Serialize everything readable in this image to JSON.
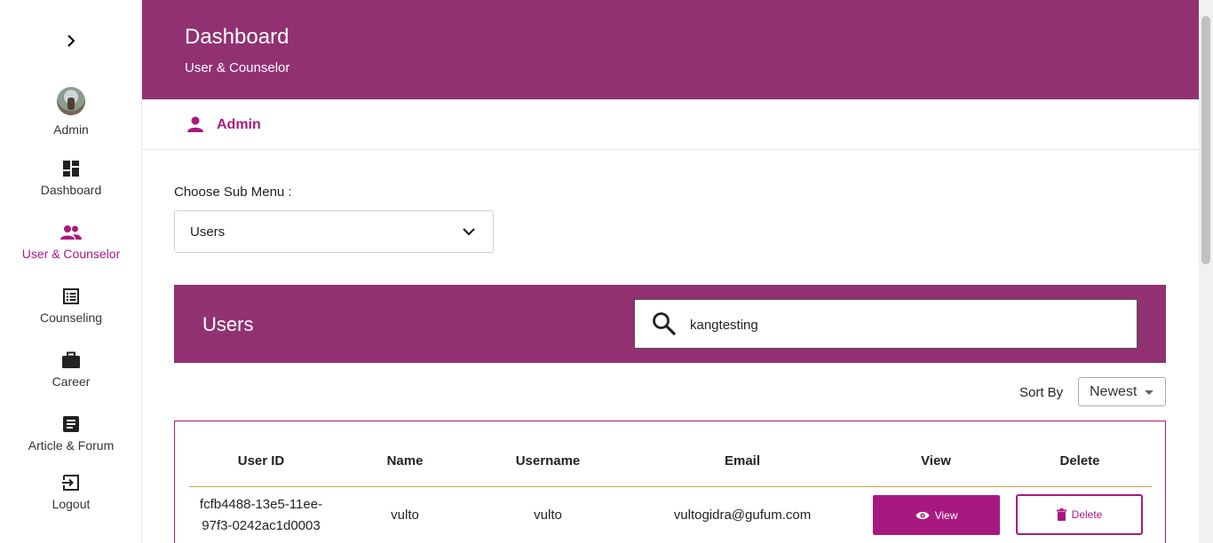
{
  "sidebar": {
    "items": [
      {
        "label": "Admin",
        "icon": "avatar"
      },
      {
        "label": "Dashboard",
        "icon": "dashboard-icon"
      },
      {
        "label": "User & Counselor",
        "icon": "people-icon",
        "active": true
      },
      {
        "label": "Counseling",
        "icon": "list-icon"
      },
      {
        "label": "Career",
        "icon": "briefcase-icon"
      },
      {
        "label": "Article & Forum",
        "icon": "article-icon"
      },
      {
        "label": "Logout",
        "icon": "logout-icon"
      }
    ]
  },
  "header": {
    "title": "Dashboard",
    "subtitle": "User & Counselor"
  },
  "admin_bar": {
    "label": "Admin"
  },
  "submenu": {
    "label": "Choose Sub Menu :",
    "selected": "Users"
  },
  "users_panel": {
    "title": "Users",
    "search_value": "kangtesting"
  },
  "sort": {
    "label": "Sort By",
    "selected": "Newest"
  },
  "table": {
    "headers": [
      "User ID",
      "Name",
      "Username",
      "Email",
      "View",
      "Delete"
    ],
    "rows": [
      {
        "user_id_line1": "fcfb4488-13e5-11ee-",
        "user_id_line2": "97f3-0242ac1d0003",
        "name": "vulto",
        "username": "vulto",
        "email": "vultogidra@gufum.com",
        "view_label": "View",
        "delete_label": "Delete"
      }
    ]
  },
  "colors": {
    "primary": "#913172",
    "accent": "#a8197f",
    "divider": "#c7a84b"
  }
}
